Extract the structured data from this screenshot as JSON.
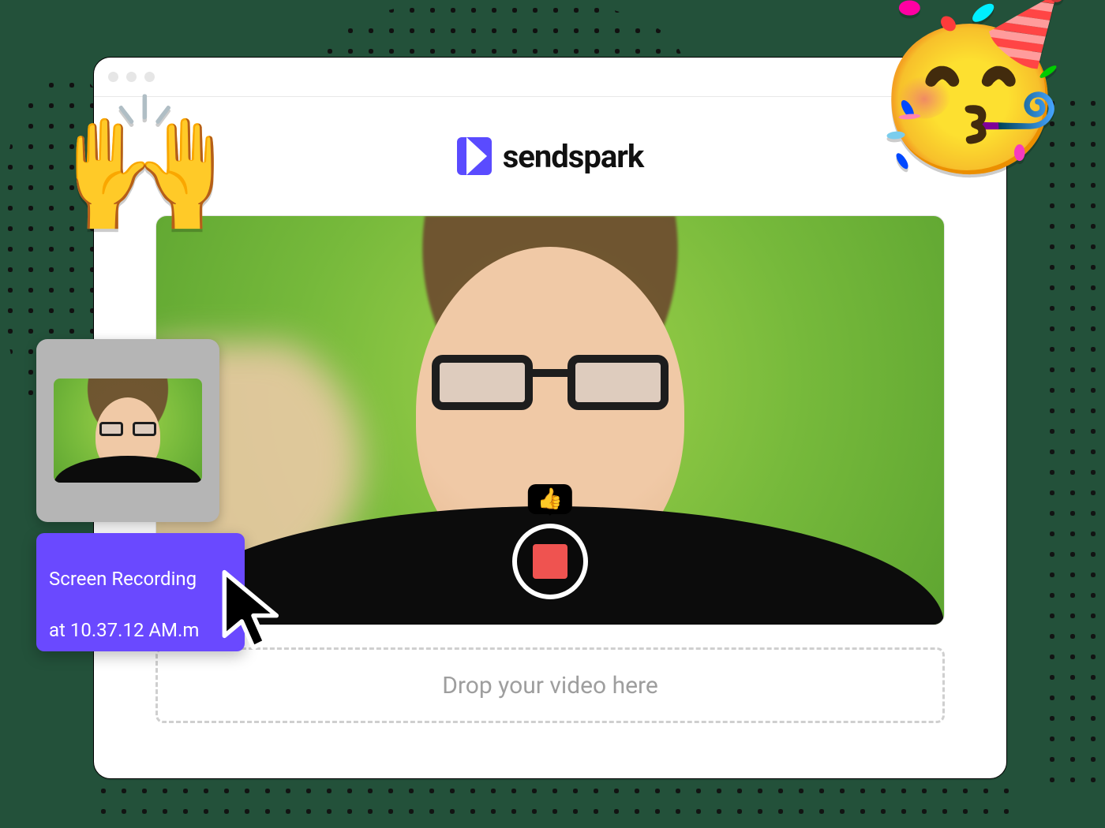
{
  "brand": {
    "name": "sendspark"
  },
  "dropzone": {
    "label": "Drop your video here"
  },
  "tooltip": {
    "thumbs_emoji": "👍"
  },
  "drag": {
    "filename_line1": "Screen Recording",
    "filename_line2": "at 10.37.12 AM.m"
  },
  "decor": {
    "party_emoji": "🥳",
    "hands_emoji": "🙌"
  }
}
